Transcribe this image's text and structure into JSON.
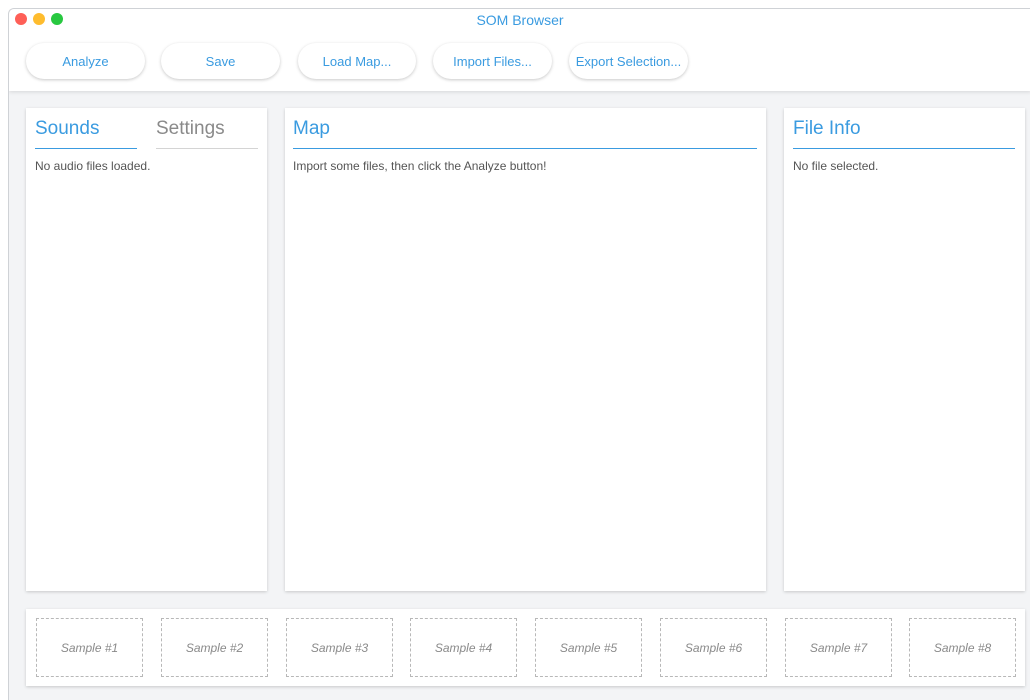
{
  "window": {
    "title": "SOM Browser"
  },
  "toolbar": {
    "analyze_label": "Analyze",
    "save_label": "Save",
    "load_map_label": "Load Map...",
    "import_files_label": "Import Files...",
    "export_selection_label": "Export Selection..."
  },
  "left_panel": {
    "tabs": [
      {
        "label": "Sounds",
        "active": true
      },
      {
        "label": "Settings",
        "active": false
      }
    ],
    "empty_message": "No audio files loaded."
  },
  "map_panel": {
    "title": "Map",
    "message": "Import some files, then click the Analyze button!"
  },
  "file_info_panel": {
    "title": "File Info",
    "message": "No file selected."
  },
  "samples": [
    {
      "label": "Sample #1"
    },
    {
      "label": "Sample #2"
    },
    {
      "label": "Sample #3"
    },
    {
      "label": "Sample #4"
    },
    {
      "label": "Sample #5"
    },
    {
      "label": "Sample #6"
    },
    {
      "label": "Sample #7"
    },
    {
      "label": "Sample #8"
    }
  ],
  "colors": {
    "accent": "#3a9be0",
    "traffic_close": "#fe5f57",
    "traffic_minimize": "#febc2e",
    "traffic_zoom": "#28c840"
  }
}
